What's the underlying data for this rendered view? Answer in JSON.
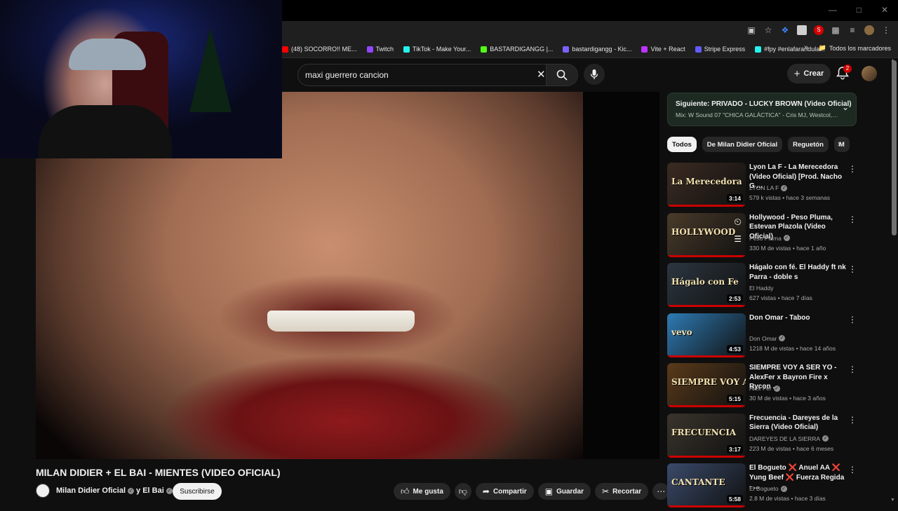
{
  "bookmarks": {
    "items": [
      {
        "label": "(48) SOCORRO!! ME...",
        "color": "#ff0000"
      },
      {
        "label": "Twitch",
        "color": "#9146ff"
      },
      {
        "label": "TikTok - Make Your...",
        "color": "#25f4ee"
      },
      {
        "label": "BASTARDIGANGG |...",
        "color": "#53fc18"
      },
      {
        "label": "bastardigangg - Kic...",
        "color": "#7b61ff"
      },
      {
        "label": "Vite + React",
        "color": "#bd34fe"
      },
      {
        "label": "Stripe Express",
        "color": "#635bff"
      },
      {
        "label": "#fpy #enlafarandula...",
        "color": "#25f4ee"
      }
    ],
    "all_label": "Todos los marcadores"
  },
  "search": {
    "query": "maxi guerrero cancion"
  },
  "header": {
    "create_label": "Crear",
    "notifications_count": "2"
  },
  "video": {
    "title": "MILAN DIDIER + EL BAI - MIENTES (VIDEO OFICIAL)",
    "channel": "Milan Didier Oficial",
    "channel_joiner": "y El Bai",
    "subscribe_label": "Suscribirse",
    "actions": {
      "like": "Me gusta",
      "share": "Compartir",
      "save": "Guardar",
      "clip": "Recortar"
    }
  },
  "up_next": {
    "title": "Siguiente: PRIVADO - LUCKY BROWN (Video Oficial)",
    "subtitle": "Mix: W Sound 07 \"CHICA GALÁCTICA\" - Cris MJ, Westcol, Ov..."
  },
  "chips": [
    "Todos",
    "De Milan Didier Oficial",
    "Reguetón",
    "M"
  ],
  "recommendations": [
    {
      "title": "Lyon La F - La Merecedora (Video Oficial) [Prod. Nacho G ...",
      "channel": "LYON LA F",
      "meta": "579 k vistas • hace 3 semanas",
      "duration": "3:14",
      "thumb_text": "La Merecedora",
      "thumb_color": "#3b2b22",
      "verified": true,
      "watch_later": false
    },
    {
      "title": "Hollywood - Peso Pluma, Estevan Plazola (Video Oficial)",
      "channel": "Peso Pluma",
      "meta": "330 M de vistas • hace 1 año",
      "duration": "",
      "thumb_text": "HOLLYWOOD",
      "thumb_color": "#4a3b2a",
      "verified": true,
      "watch_later": true
    },
    {
      "title": "Hágalo con fé. El Haddy ft nk Parra - doble s",
      "channel": "El Haddy",
      "meta": "627 vistas • hace 7 días",
      "duration": "2:53",
      "thumb_text": "Hágalo con Fe",
      "thumb_color": "#2c3640",
      "verified": false,
      "watch_later": false
    },
    {
      "title": "Don Omar - Taboo",
      "channel": "Don Omar",
      "meta": "1218 M de vistas • hace 14 años",
      "duration": "4:53",
      "thumb_text": "vevo",
      "thumb_color": "#2e7bb4",
      "verified": true,
      "watch_later": false
    },
    {
      "title": "SIEMPRE VOY A SER YO - AlexFer x Bayron Fire x Rycon ...",
      "channel": "Alex Fer",
      "meta": "30 M de vistas • hace 3 años",
      "duration": "5:15",
      "thumb_text": "SIEMPRE VOY A SER YO",
      "thumb_color": "#5a3a1a",
      "verified": true,
      "watch_later": false
    },
    {
      "title": "Frecuencia - Dareyes de la Sierra (Video Oficial)",
      "channel": "DAREYES DE LA SIERRA",
      "meta": "223 M de vistas • hace 6 meses",
      "duration": "3:17",
      "thumb_text": "FRECUENCIA",
      "thumb_color": "#3a342c",
      "verified": true,
      "watch_later": false
    },
    {
      "title": "El Bogueto ❌ Anuel AA ❌ Yung Beef ❌ Fuerza Regida - ...",
      "channel": "El Bogueto",
      "meta": "2.8 M de vistas • hace 3 días",
      "duration": "5:58",
      "thumb_text": "CANTANTE",
      "thumb_color": "#3a4a6a",
      "verified": true,
      "watch_later": false
    }
  ]
}
